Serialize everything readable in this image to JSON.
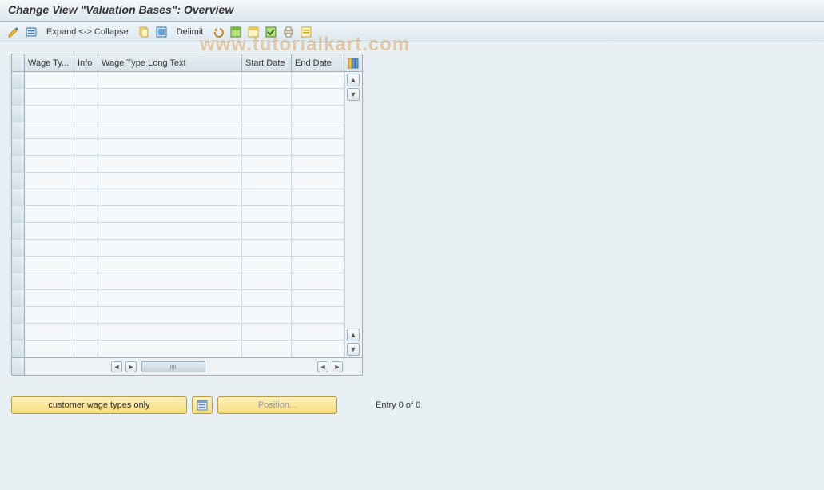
{
  "title": "Change View \"Valuation Bases\": Overview",
  "watermark": "www.tutorialkart.com",
  "toolbar": {
    "expand_collapse": "Expand <-> Collapse",
    "delimit": "Delimit"
  },
  "table": {
    "columns": {
      "wage_type": "Wage Ty...",
      "info": "Info",
      "long_text": "Wage Type Long Text",
      "start_date": "Start Date",
      "end_date": "End Date"
    },
    "row_count": 17
  },
  "footer": {
    "customer_btn": "customer wage types only",
    "position_btn": "Position...",
    "entry_text": "Entry 0 of 0"
  },
  "colors": {
    "bg": "#e8f0f4",
    "button": "#f6dd7a"
  }
}
